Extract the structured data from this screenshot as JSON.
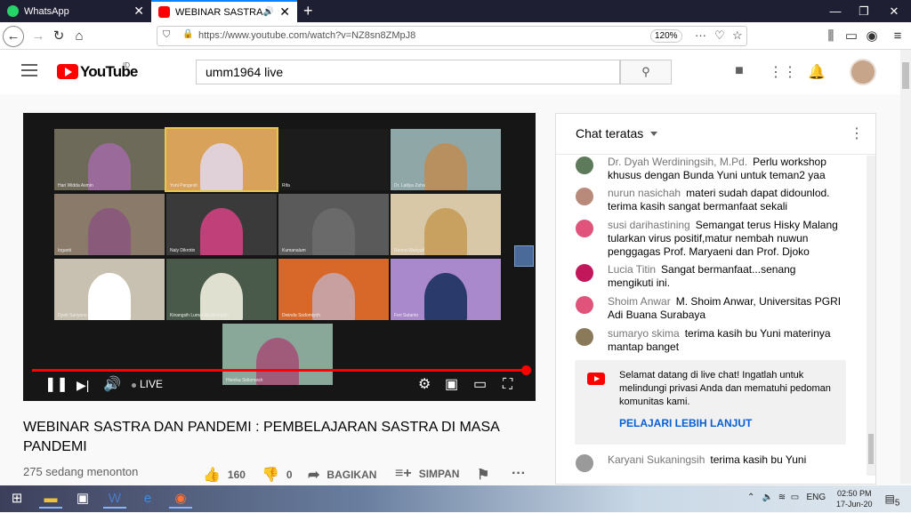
{
  "browser": {
    "tabs": [
      {
        "label": "WhatsApp",
        "color": "#25d366"
      },
      {
        "label": "WEBINAR SASTRA DAN PAN",
        "color": "#ff0000"
      }
    ],
    "url": "https://www.youtube.com/watch?v=NZ8sn8ZMpJ8",
    "zoom": "120%"
  },
  "youtube": {
    "logo_text": "YouTube",
    "region": "ID",
    "search_value": "umm1964 live"
  },
  "video": {
    "live_label": "LIVE",
    "participants": [
      "Hari Widda Asmin",
      "Yuni Pangesti",
      "Rifa",
      "Dr. Lailiya Zuha",
      "Inganti",
      "Naly Dikrotin",
      "Kumanalum",
      "Renna Wahyuti",
      "Dyah Sariyono",
      "Kinangsih Lumar Murtiningsih",
      "Dwinda Sodomiyoh",
      "Feri Sutanto",
      "Hienika Sidiomesh"
    ],
    "title": "WEBINAR SASTRA DAN PANDEMI : PEMBELAJARAN SASTRA DI MASA PANDEMI",
    "views": "275 sedang menonton",
    "likes": "160",
    "dislikes": "0",
    "share_label": "BAGIKAN",
    "save_label": "SIMPAN"
  },
  "chat": {
    "title": "Chat teratas",
    "messages": [
      {
        "author": "Dr. Dyah Werdiningsih, M.Pd.",
        "text": "Perlu workshop khusus dengan Bunda Yuni untuk teman2 yaa",
        "color": "#5d7a5a"
      },
      {
        "author": "nurun nasichah",
        "text": "materi sudah dapat didounlod. terima kasih sangat bermanfaat sekali",
        "color": "#b78a7a"
      },
      {
        "author": "susi darihastining",
        "text": "Semangat terus Hisky Malang tularkan virus positif,matur nembah nuwun penggagas Prof. Maryaeni dan Prof. Djoko",
        "color": "#e0537a"
      },
      {
        "author": "Lucia Titin",
        "text": "Sangat bermanfaat...senang mengikuti ini.",
        "color": "#c2185b"
      },
      {
        "author": "Shoim Anwar",
        "text": "M. Shoim Anwar, Universitas PGRI Adi Buana Surabaya",
        "color": "#e0537a"
      },
      {
        "author": "sumaryo skima",
        "text": "terima kasih bu Yuni materinya mantap banget",
        "color": "#8a7a5a"
      },
      {
        "author": "Karyani Sukaningsih",
        "text": "terima kasih bu Yuni",
        "color": "#9a9a9a"
      }
    ],
    "welcome_text": "Selamat datang di live chat! Ingatlah untuk melindungi privasi Anda dan mematuhi pedoman komunitas kami.",
    "welcome_link": "PELAJARI LEBIH LANJUT"
  },
  "taskbar": {
    "language": "ENG",
    "time": "02:50 PM",
    "date": "17-Jun-20",
    "notifications": "5"
  }
}
